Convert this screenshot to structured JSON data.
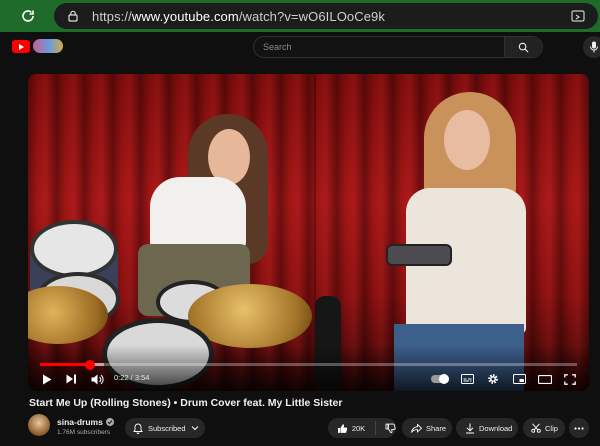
{
  "browser": {
    "url_prefix": "https://",
    "url_domain": "www.youtube.com",
    "url_path": "/watch?v=wO6ILOoCe9k"
  },
  "header": {
    "search_placeholder": "Search"
  },
  "player": {
    "current_time": "0:22",
    "duration": "3:54",
    "time_display": "0:22 / 3:54",
    "progress_fraction": 0.094,
    "buffered_fraction": 0.12,
    "hd_badge": "HD"
  },
  "video": {
    "title": "Start Me Up (Rolling Stones) • Drum Cover feat. My Little Sister"
  },
  "channel": {
    "name": "sina-drums",
    "subscribers": "1.76M subscribers",
    "subscribed_label": "Subscribed"
  },
  "actions": {
    "like_count": "20K",
    "share_label": "Share",
    "download_label": "Download",
    "clip_label": "Clip"
  },
  "colors": {
    "browser_bar": "#1f6b2a",
    "progress": "#ff0000",
    "pill_bg": "#272727"
  }
}
